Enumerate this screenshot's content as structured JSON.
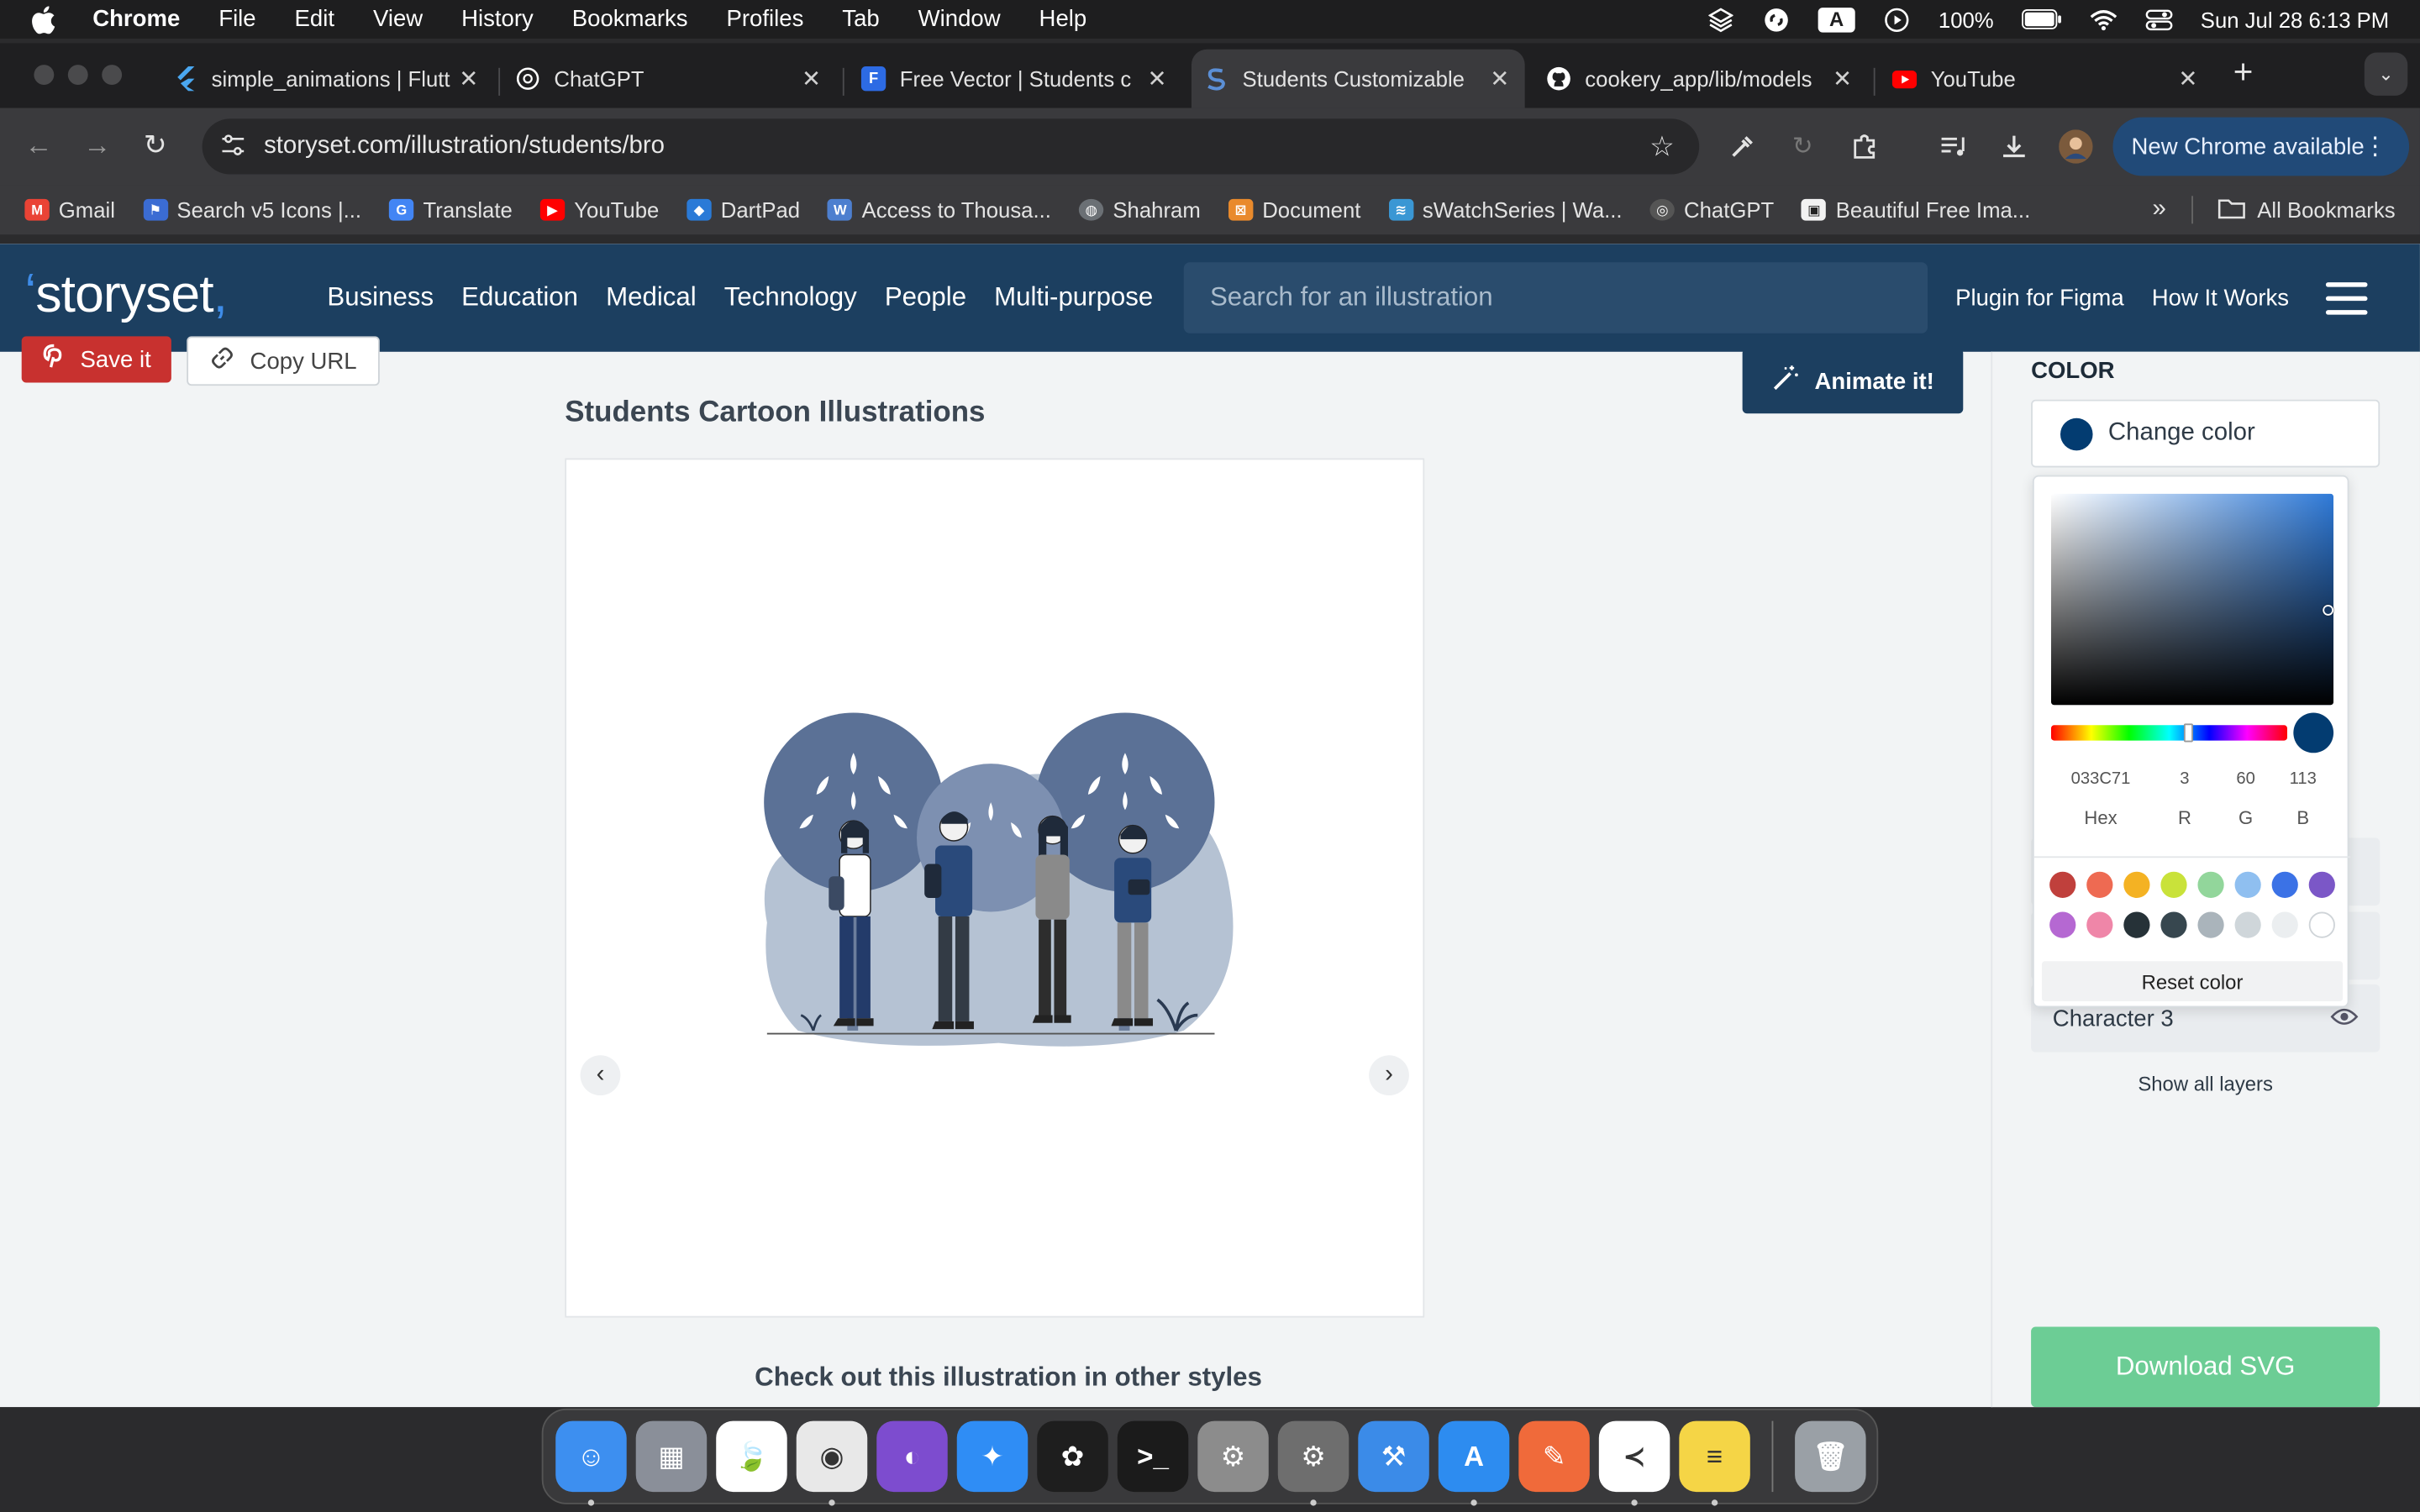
{
  "menubar": {
    "app": "Chrome",
    "items": [
      "File",
      "Edit",
      "View",
      "History",
      "Bookmarks",
      "Profiles",
      "Tab",
      "Window",
      "Help"
    ],
    "battery": "100%",
    "input_letter": "A",
    "datetime": "Sun Jul 28  6:13 PM"
  },
  "tabs": [
    {
      "title": "simple_animations | Flutt",
      "icon": "flutter-icon",
      "color": "#4aa7f0"
    },
    {
      "title": "ChatGPT",
      "icon": "chatgpt-icon",
      "color": "#ffffff"
    },
    {
      "title": "Free Vector | Students c",
      "icon": "freepik-icon",
      "color": "#2d6be4"
    },
    {
      "title": "Students Customizable",
      "icon": "storyset-icon",
      "color": "#2f5e9c"
    },
    {
      "title": "cookery_app/lib/models",
      "icon": "github-icon",
      "color": "#ffffff"
    },
    {
      "title": "YouTube",
      "icon": "youtube-icon",
      "color": "#ff0000"
    }
  ],
  "address": {
    "url": "storyset.com/illustration/students/bro",
    "new_chrome_label": "New Chrome available"
  },
  "bookmarks": [
    {
      "label": "Gmail",
      "color": "#ea4335",
      "icon": "gmail-icon"
    },
    {
      "label": "Search v5 Icons |...",
      "color": "#3b6cd3",
      "icon": "fontawesome-icon"
    },
    {
      "label": "Translate",
      "color": "#4285f4",
      "icon": "translate-icon"
    },
    {
      "label": "YouTube",
      "color": "#ff0000",
      "icon": "youtube-icon"
    },
    {
      "label": "DartPad",
      "color": "#2a7ad7",
      "icon": "dart-icon"
    },
    {
      "label": "Access to Thousa...",
      "color": "#4d7fcf",
      "icon": "w-icon"
    },
    {
      "label": "Shahram",
      "color": "#9aa0a6",
      "icon": "globe-icon"
    },
    {
      "label": "Document",
      "color": "#e98a2c",
      "icon": "xampp-icon"
    },
    {
      "label": "sWatchSeries | Wa...",
      "color": "#3a97d4",
      "icon": "swatch-icon"
    },
    {
      "label": "ChatGPT",
      "color": "#dcdcdc",
      "icon": "chatgpt-icon"
    },
    {
      "label": "Beautiful Free Ima...",
      "color": "#f2f2f2",
      "icon": "unsplash-icon"
    }
  ],
  "all_bookmarks": "All Bookmarks",
  "site": {
    "logo": "storyset",
    "categories": [
      "Business",
      "Education",
      "Medical",
      "Technology",
      "People",
      "Multi-purpose"
    ],
    "search_placeholder": "Search for an illustration",
    "plugin": "Plugin for Figma",
    "how": "How It Works",
    "save": "Save it",
    "copy": "Copy URL",
    "animate": "Animate it!",
    "title": "Students Cartoon Illustrations",
    "other_styles": "Check out this illustration in other styles",
    "color_heading": "COLOR",
    "change_color": "Change color",
    "character3": "Character 3",
    "show_layers": "Show all layers",
    "download": "Download SVG"
  },
  "picker": {
    "hex": "033C71",
    "r": "3",
    "g": "60",
    "b": "113",
    "hex_label": "Hex",
    "r_label": "R",
    "g_label": "G",
    "b_label": "B",
    "current_color": "#033c71",
    "palette_row1": [
      "#c0403c",
      "#ee6a52",
      "#f4b223",
      "#c9e23a",
      "#92d69b",
      "#8fbff0",
      "#3b72e6",
      "#7b57c7"
    ],
    "palette_row2": [
      "#b568d2",
      "#ef86a8",
      "#263238",
      "#37474f",
      "#aab4bb",
      "#cfd6da",
      "#ebeef0",
      "#ffffff"
    ],
    "reset": "Reset color"
  },
  "dock": [
    {
      "name": "finder-icon",
      "color": "#3d8ff0",
      "glyph": "☺",
      "running": true
    },
    {
      "name": "launchpad-icon",
      "color": "#8a8f99",
      "glyph": "▦",
      "running": false
    },
    {
      "name": "mongodb-compass-icon",
      "color": "#ffffff",
      "glyph": "🍃",
      "running": false
    },
    {
      "name": "chrome-icon",
      "color": "#e8e8e8",
      "glyph": "◉",
      "running": true
    },
    {
      "name": "github-desktop-icon",
      "color": "#7d4ccf",
      "glyph": "◐",
      "running": false
    },
    {
      "name": "safari-icon",
      "color": "#2f8df5",
      "glyph": "✦",
      "running": false
    },
    {
      "name": "figma-icon",
      "color": "#1e1e1e",
      "glyph": "✿",
      "running": false
    },
    {
      "name": "terminal-icon",
      "color": "#1b1b1b",
      "glyph": ">_",
      "running": false
    },
    {
      "name": "system-settings-icon",
      "color": "#8c8c8c",
      "glyph": "⚙",
      "running": false
    },
    {
      "name": "settings-icon",
      "color": "#6e6e6e",
      "glyph": "⚙",
      "running": true
    },
    {
      "name": "xcode-icon",
      "color": "#3b8be8",
      "glyph": "⚒",
      "running": false
    },
    {
      "name": "app-store-icon",
      "color": "#2d8cf0",
      "glyph": "A",
      "running": true
    },
    {
      "name": "pen-app-icon",
      "color": "#f06a3a",
      "glyph": "✎",
      "running": false
    },
    {
      "name": "vscode-icon",
      "color": "#ffffff",
      "glyph": "≺",
      "running": true
    },
    {
      "name": "notes-icon",
      "color": "#f5d546",
      "glyph": "≡",
      "running": true
    },
    {
      "name": "trash-icon",
      "color": "#9aa0a6",
      "glyph": "🗑",
      "running": false
    }
  ]
}
